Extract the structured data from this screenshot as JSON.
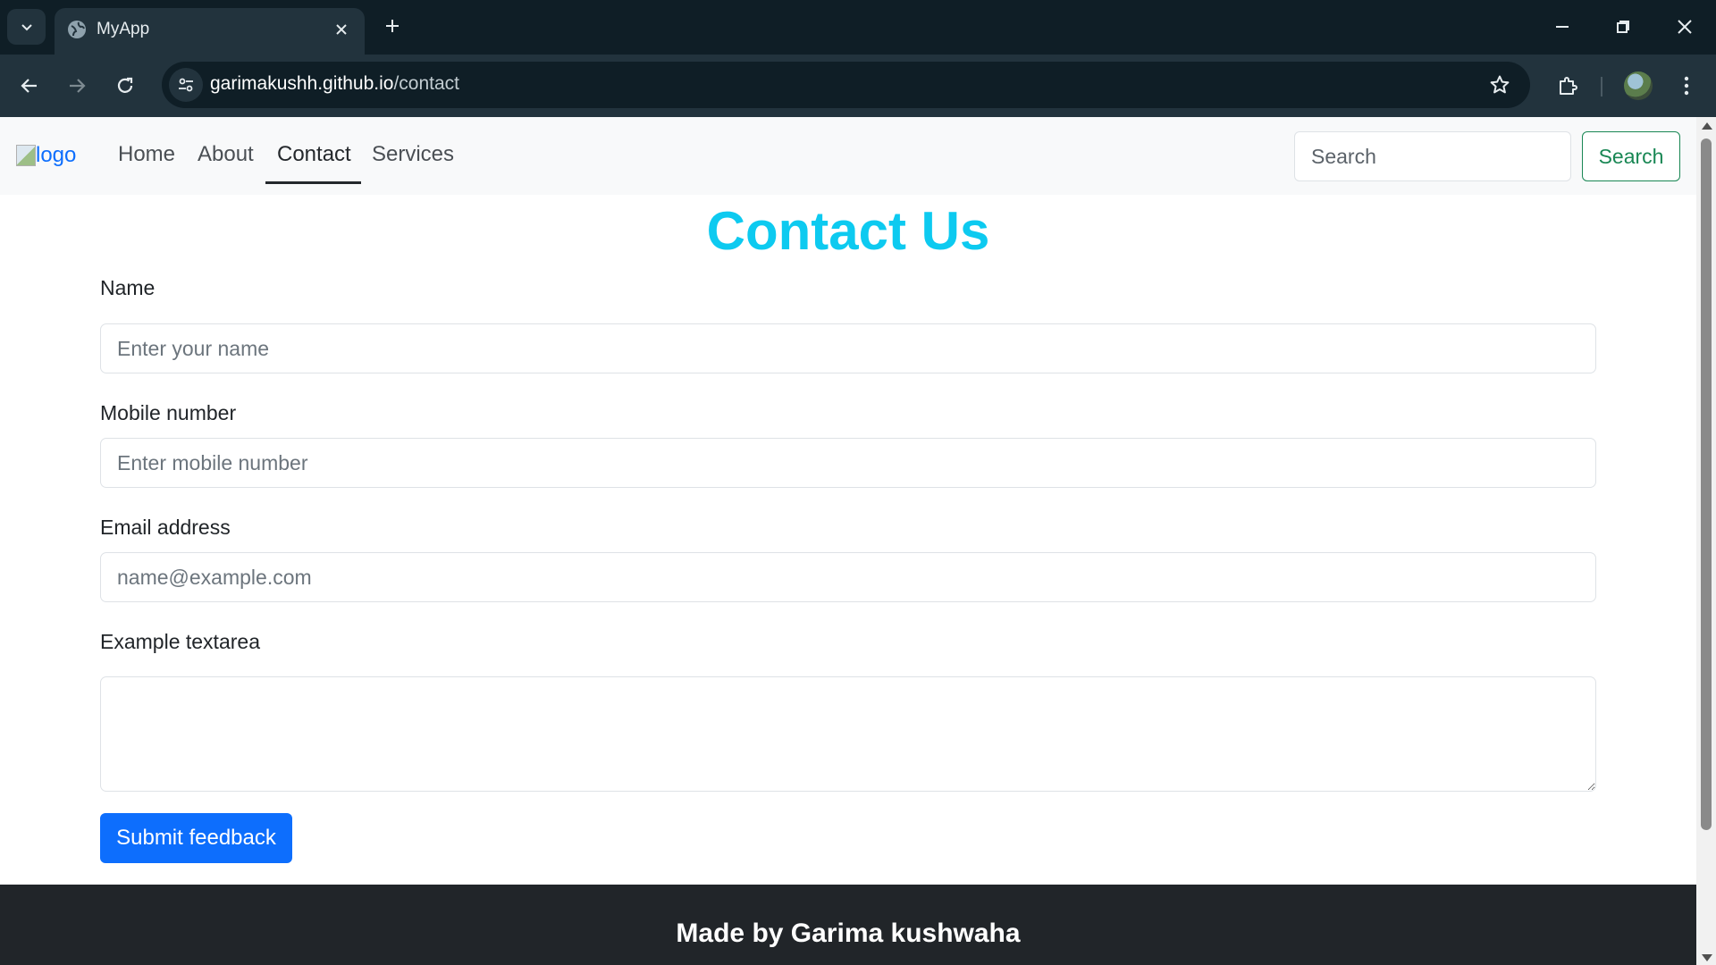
{
  "browser": {
    "tab_title": "MyApp",
    "url_host": "garimakushh.github.io",
    "url_path": "/contact"
  },
  "navbar": {
    "logo_alt": "logo",
    "links": [
      {
        "label": "Home"
      },
      {
        "label": "About"
      },
      {
        "label": "Contact",
        "active": true
      },
      {
        "label": "Services"
      }
    ],
    "search_placeholder": "Search",
    "search_button": "Search"
  },
  "main": {
    "heading": "Contact Us",
    "fields": {
      "name": {
        "label": "Name",
        "placeholder": "Enter your name",
        "value": ""
      },
      "mobile": {
        "label": "Mobile number",
        "placeholder": "Enter mobile number",
        "value": ""
      },
      "email": {
        "label": "Email address",
        "placeholder": "name@example.com",
        "value": ""
      },
      "message": {
        "label": "Example textarea",
        "value": ""
      }
    },
    "submit_label": "Submit feedback"
  },
  "footer": {
    "text": "Made by Garima kushwaha"
  },
  "colors": {
    "heading": "#0dcaf0",
    "primary_button": "#0d6efd",
    "search_button": "#198754",
    "footer_bg": "#212529",
    "navbar_bg": "#f8f9fa"
  },
  "icons": [
    "tab-search-icon",
    "globe-icon",
    "close-icon",
    "plus-icon",
    "minimize-icon",
    "restore-icon",
    "window-close-icon",
    "back-arrow-icon",
    "forward-arrow-icon",
    "reload-icon",
    "site-settings-icon",
    "star-icon",
    "extensions-icon",
    "profile-avatar",
    "kebab-menu-icon"
  ]
}
